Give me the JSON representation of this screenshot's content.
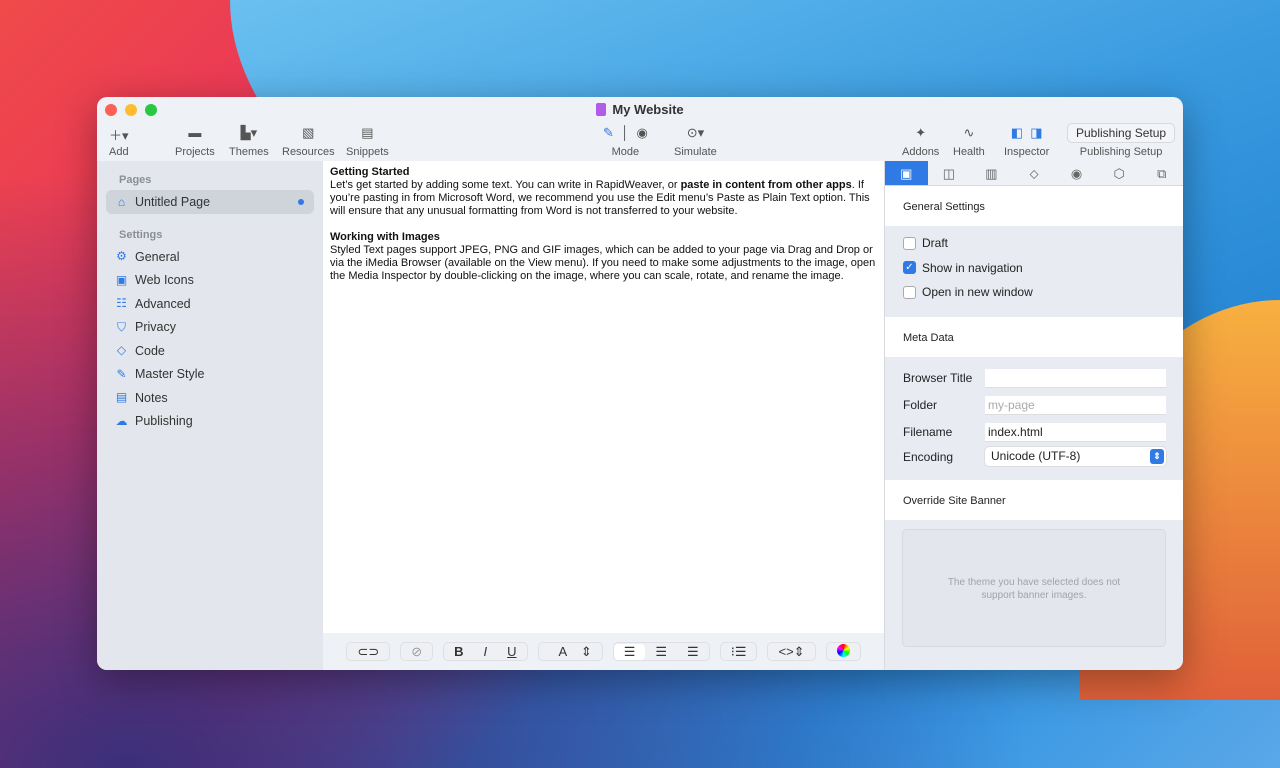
{
  "window": {
    "title": "My Website"
  },
  "toolbar": {
    "add": "Add",
    "projects": "Projects",
    "themes": "Themes",
    "resources": "Resources",
    "snippets": "Snippets",
    "mode": "Mode",
    "simulate": "Simulate",
    "addons": "Addons",
    "health": "Health",
    "inspector": "Inspector",
    "publishing_setup_button": "Publishing Setup",
    "publishing_setup": "Publishing Setup"
  },
  "sidebar": {
    "pages_header": "Pages",
    "page": "Untitled Page",
    "settings_header": "Settings",
    "items": [
      {
        "label": "General",
        "icon": "⚙"
      },
      {
        "label": "Web Icons",
        "icon": "▣"
      },
      {
        "label": "Advanced",
        "icon": "☷"
      },
      {
        "label": "Privacy",
        "icon": "⛉"
      },
      {
        "label": "Code",
        "icon": "◇"
      },
      {
        "label": "Master Style",
        "icon": "✎"
      },
      {
        "label": "Notes",
        "icon": "▤"
      },
      {
        "label": "Publishing",
        "icon": "☁"
      }
    ]
  },
  "editor": {
    "h1": "Getting Started",
    "p1a": "Let’s get started by adding some text. You can write in RapidWeaver, or ",
    "p1b": "paste in content from other apps",
    "p1c": ". If you’re pasting in from Microsoft Word, we recommend you use the Edit menu’s Paste as Plain Text option. This will ensure that any unusual formatting from Word is not transferred to your website.",
    "h2": "Working with Images",
    "p2": "Styled Text pages support JPEG, PNG and GIF images, which can be added to your page via Drag and Drop or via the iMedia Browser (available on the View menu). If you need to make some adjustments to the image, open the Media Inspector by double-clicking on the image, where you can scale, rotate, and rename the image."
  },
  "format": {
    "bold": "B",
    "italic": "I",
    "underline": "U",
    "font": "A"
  },
  "inspector": {
    "general_settings": "General Settings",
    "draft": "Draft",
    "show_nav": "Show in navigation",
    "new_window": "Open in new window",
    "meta_data": "Meta Data",
    "browser_title_label": "Browser Title",
    "browser_title": "",
    "folder_label": "Folder",
    "folder_placeholder": "my-page",
    "filename_label": "Filename",
    "filename": "index.html",
    "encoding_label": "Encoding",
    "encoding": "Unicode (UTF-8)",
    "override_banner": "Override Site Banner",
    "banner_note": "The theme you have selected does not support banner images."
  }
}
